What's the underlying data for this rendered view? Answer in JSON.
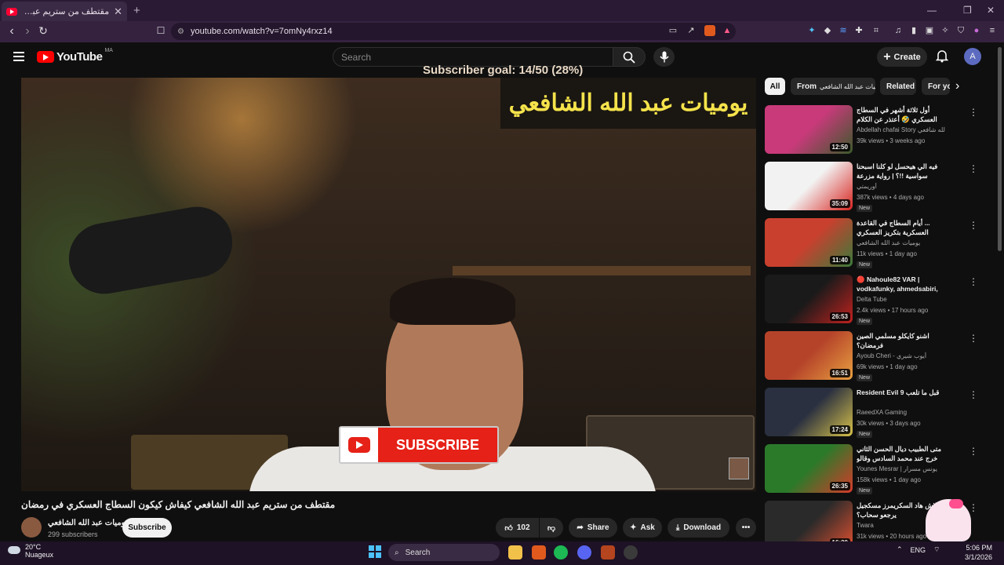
{
  "browser": {
    "tab_title": "مقتطف من ستريم عبد الله الشافعي",
    "new_tab": "+",
    "url": "youtube.com/watch?v=7omNy4rxz14"
  },
  "header": {
    "logo_text": "YouTube",
    "country_code": "MA",
    "search_placeholder": "Search",
    "create_label": "Create",
    "avatar_initial": "A"
  },
  "video": {
    "subscriber_goal": "Subscriber goal: 14/50 (28%)",
    "overlay_title": "يوميات عبد الله الشافعي",
    "subscribe_overlay": "SUBSCRIBE",
    "title": "مقتطف من ستريم عبد الله الشافعي كيفاش كيكون السطاج العسكري في رمضان",
    "channel_name": "يوميات عبد الله الشافعي",
    "channel_subs": "299 subscribers",
    "subscribe_label": "Subscribe",
    "likes": "102",
    "share_label": "Share",
    "ask_label": "Ask",
    "download_label": "Download"
  },
  "chips": [
    "All",
    "From",
    "يوميات عبد الله الشافعي",
    "Related",
    "For yo"
  ],
  "recommendations": [
    {
      "title": "أول ثلاثة أشهر في السطاج العسكري 🤣 أعتذر عن الكلام النابي 🤣",
      "channel": "Abdellah chafai Story عبد الله شافعي",
      "meta": "39k views • 3 weeks ago",
      "duration": "12:50",
      "badge": "",
      "thumb_colors": [
        "#c83a7a",
        "#3a5a2a"
      ]
    },
    {
      "title": "فيه الي هيحسل لو كلنا اسبحنا سواسية !!؟ | رواية مزرعة الحيوان",
      "channel": "أوريمتي",
      "meta": "387k views • 4 days ago",
      "duration": "35:09",
      "badge": "New",
      "thumb_colors": [
        "#f2f2f2",
        "#d8241f"
      ]
    },
    {
      "title": "... أيام السطاج في القاعدة العسكرية بتكريز العسكري السابق عبد الله الشافعي يحكي",
      "channel": "يوميات عبد الله الشافعي",
      "meta": "11k views • 1 day ago",
      "duration": "11:40",
      "badge": "New",
      "thumb_colors": [
        "#c9402f",
        "#3a7a3a"
      ]
    },
    {
      "title": "🔴 Nahoule82 VAR | vodkafunky, ahmedsabiri, ...",
      "channel": "Delta Tube",
      "meta": "2.4k views • 17 hours ago",
      "duration": "26:53",
      "badge": "New",
      "thumb_colors": [
        "#1a1a1a",
        "#c2221f"
      ]
    },
    {
      "title": "اشنو كايكلو مسلمي الصين فرمضان؟",
      "channel": "Ayoub Cheri - أيوب شيري",
      "meta": "69k views • 1 day ago",
      "duration": "16:51",
      "badge": "New",
      "thumb_colors": [
        "#b5432a",
        "#e8a040"
      ]
    },
    {
      "title": "Resident Evil 9 قبل ما تلعب",
      "channel": "RaeedXA Gaming",
      "meta": "30k views • 3 days ago",
      "duration": "17:24",
      "badge": "New",
      "thumb_colors": [
        "#2a3040",
        "#d8c24a"
      ]
    },
    {
      "title": "متى الطبيب ديال الحسن الثاني خرج عند محمد السادس وقالو بابك مات . شنو طرا في ...",
      "channel": "Younes Mesrar | يونس مسرار",
      "meta": "158k views • 1 day ago",
      "duration": "26:35",
      "badge": "New",
      "thumb_colors": [
        "#2a7a2a",
        "#d63a2a"
      ]
    },
    {
      "title": "علاش هاد السكريمرز مسكجيل يرجعو سحاب؟",
      "channel": "Twara",
      "meta": "31k views • 20 hours ago",
      "duration": "16:20",
      "badge": "",
      "thumb_colors": [
        "#2a2a2a",
        "#e05030"
      ]
    }
  ],
  "taskbar": {
    "temperature": "20°C",
    "weather": "Nuageux",
    "search_label": "Search",
    "lang": "ENG",
    "time": "5:06 PM",
    "date": "3/1/2026"
  }
}
